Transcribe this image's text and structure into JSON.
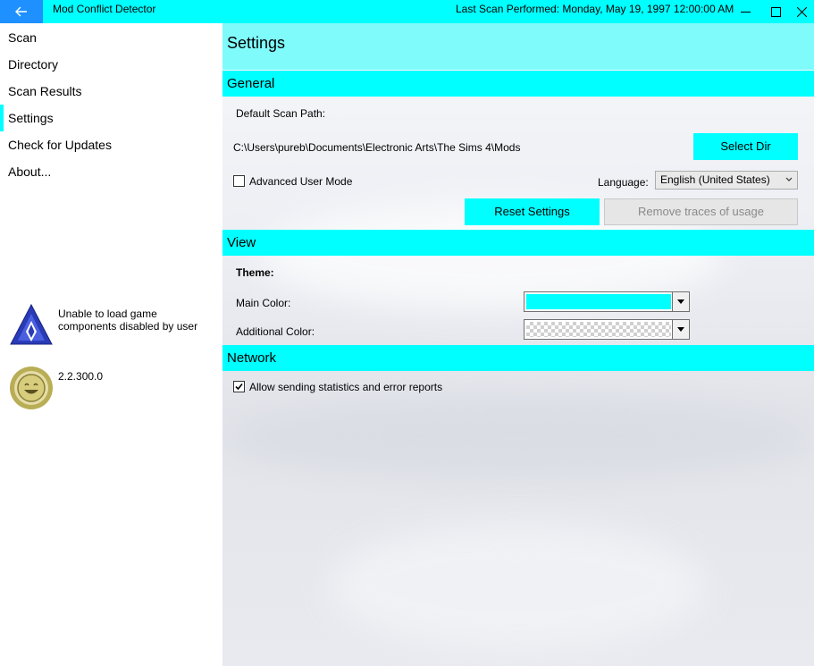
{
  "titlebar": {
    "app_title": "Mod Conflict Detector",
    "last_scan": "Last Scan Performed: Monday, May 19, 1997 12:00:00 AM",
    "accent_color": "#00ffff",
    "back_color": "#1e90ff"
  },
  "sidebar": {
    "items": [
      {
        "label": "Scan"
      },
      {
        "label": "Directory"
      },
      {
        "label": "Scan Results"
      },
      {
        "label": "Settings",
        "active": true
      },
      {
        "label": "Check for Updates"
      },
      {
        "label": "About..."
      }
    ],
    "status_message": "Unable to load game components disabled by user",
    "version": "2.2.300.0"
  },
  "page": {
    "title": "Settings"
  },
  "general": {
    "header": "General",
    "default_scan_path_label": "Default Scan Path:",
    "scan_path_value": "C:\\Users\\pureb\\Documents\\Electronic Arts\\The Sims 4\\Mods",
    "select_dir_label": "Select Dir",
    "advanced_mode_label": "Advanced User Mode",
    "advanced_mode_checked": false,
    "language_label": "Language:",
    "language_value": "English (United States)",
    "reset_label": "Reset Settings",
    "remove_traces_label": "Remove traces of usage"
  },
  "view": {
    "header": "View",
    "theme_label": "Theme:",
    "main_color_label": "Main Color:",
    "main_color_value": "#00ffff",
    "additional_color_label": "Additional Color:",
    "additional_color_value": "transparent"
  },
  "network": {
    "header": "Network",
    "statistics_label": "Allow sending statistics and error reports",
    "statistics_checked": true
  }
}
